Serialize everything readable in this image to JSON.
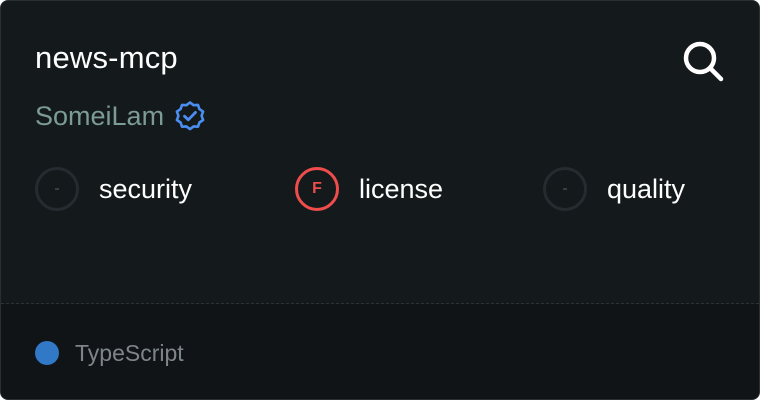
{
  "server": {
    "name": "news-mcp",
    "author": "SomeiLam",
    "author_verified": true
  },
  "icons": {
    "search": "search-icon",
    "verified": "verified-badge-icon"
  },
  "scores": [
    {
      "grade": "-",
      "label": "security",
      "status": "none"
    },
    {
      "grade": "F",
      "label": "license",
      "status": "fail"
    },
    {
      "grade": "-",
      "label": "quality",
      "status": "none"
    }
  ],
  "footer": {
    "language": "TypeScript",
    "language_color": "#3178c6"
  },
  "colors": {
    "background": "#14191c",
    "footer_background": "#101417",
    "fail": "#ef4c4c",
    "author": "#7b9b94",
    "verified": "#4b8ef0"
  }
}
